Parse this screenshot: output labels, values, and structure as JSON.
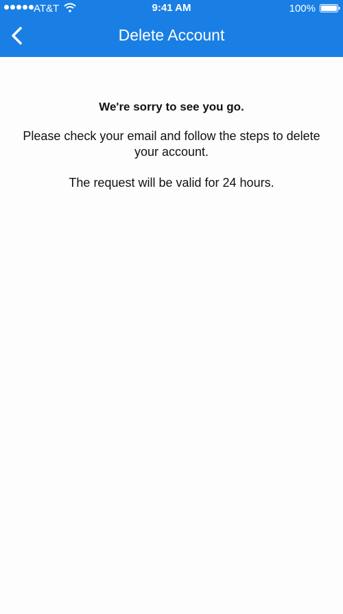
{
  "status_bar": {
    "carrier": "AT&T",
    "time": "9:41 AM",
    "battery_percent": "100%",
    "signal_icon": "signal-dots-icon",
    "wifi_icon": "wifi-icon",
    "battery_icon": "battery-full-icon"
  },
  "nav_bar": {
    "title": "Delete Account",
    "back_icon": "chevron-left-icon",
    "background_color": "#1a7fe4",
    "text_color": "#ffffff"
  },
  "content": {
    "heading": "We're sorry to see you go.",
    "message": "Please check your email and follow the steps to delete your account.",
    "validity": "The request will be valid for 24 hours."
  }
}
